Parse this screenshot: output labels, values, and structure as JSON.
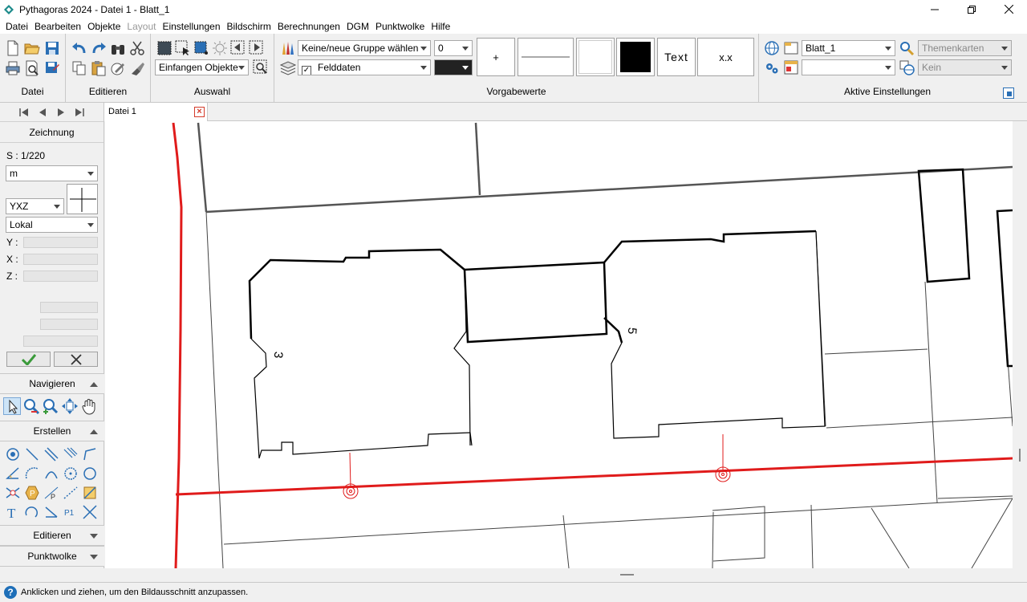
{
  "window": {
    "title": "Pythagoras 2024 - Datei 1 - Blatt_1",
    "controls": [
      "minimize",
      "maximize",
      "close"
    ]
  },
  "menu": [
    {
      "label": "Datei",
      "enabled": true
    },
    {
      "label": "Bearbeiten",
      "enabled": true
    },
    {
      "label": "Objekte",
      "enabled": true
    },
    {
      "label": "Layout",
      "enabled": false
    },
    {
      "label": "Einstellungen",
      "enabled": true
    },
    {
      "label": "Bildschirm",
      "enabled": true
    },
    {
      "label": "Berechnungen",
      "enabled": true
    },
    {
      "label": "DGM",
      "enabled": true
    },
    {
      "label": "Punktwolke",
      "enabled": true
    },
    {
      "label": "Hilfe",
      "enabled": true
    }
  ],
  "ribbon": {
    "datei_label": "Datei",
    "editieren_label": "Editieren",
    "auswahl": {
      "label": "Auswahl",
      "capture_mode": "Einfangen Objekte"
    },
    "vorgabewerte": {
      "label": "Vorgabewerte",
      "group_select": "Keine/neue Gruppe wählen",
      "layer_value": "0",
      "layer_checked": true,
      "layer_name": "Felddaten",
      "point_symbol": "+",
      "text_sample": "Text",
      "number_sample": "x.x"
    },
    "aktive": {
      "label": "Aktive Einstellungen",
      "sheet": "Blatt_1",
      "second": "",
      "themes_placeholder": "Themenkarten",
      "coord_placeholder": "Kein"
    }
  },
  "tabs": [
    {
      "label": "Datei 1",
      "active": true
    }
  ],
  "left_panel": {
    "title": "Zeichnung",
    "scale": "S : 1/220",
    "unit": "m",
    "axis_order": "YXZ",
    "coord_system": "Lokal",
    "y_label": "Y :",
    "x_label": "X :",
    "z_label": "Z :",
    "sections": {
      "navigieren": "Navigieren",
      "erstellen": "Erstellen",
      "editieren": "Editieren",
      "punktwolke": "Punktwolke"
    }
  },
  "drawing": {
    "house_numbers": [
      "3",
      "5"
    ]
  },
  "colors": {
    "accent_red": "#e01b1b",
    "ok_green": "#3a9a3a",
    "icon_blue": "#2a6fb5"
  },
  "status": {
    "message": "Anklicken und ziehen, um den Bildausschnitt anzupassen."
  }
}
